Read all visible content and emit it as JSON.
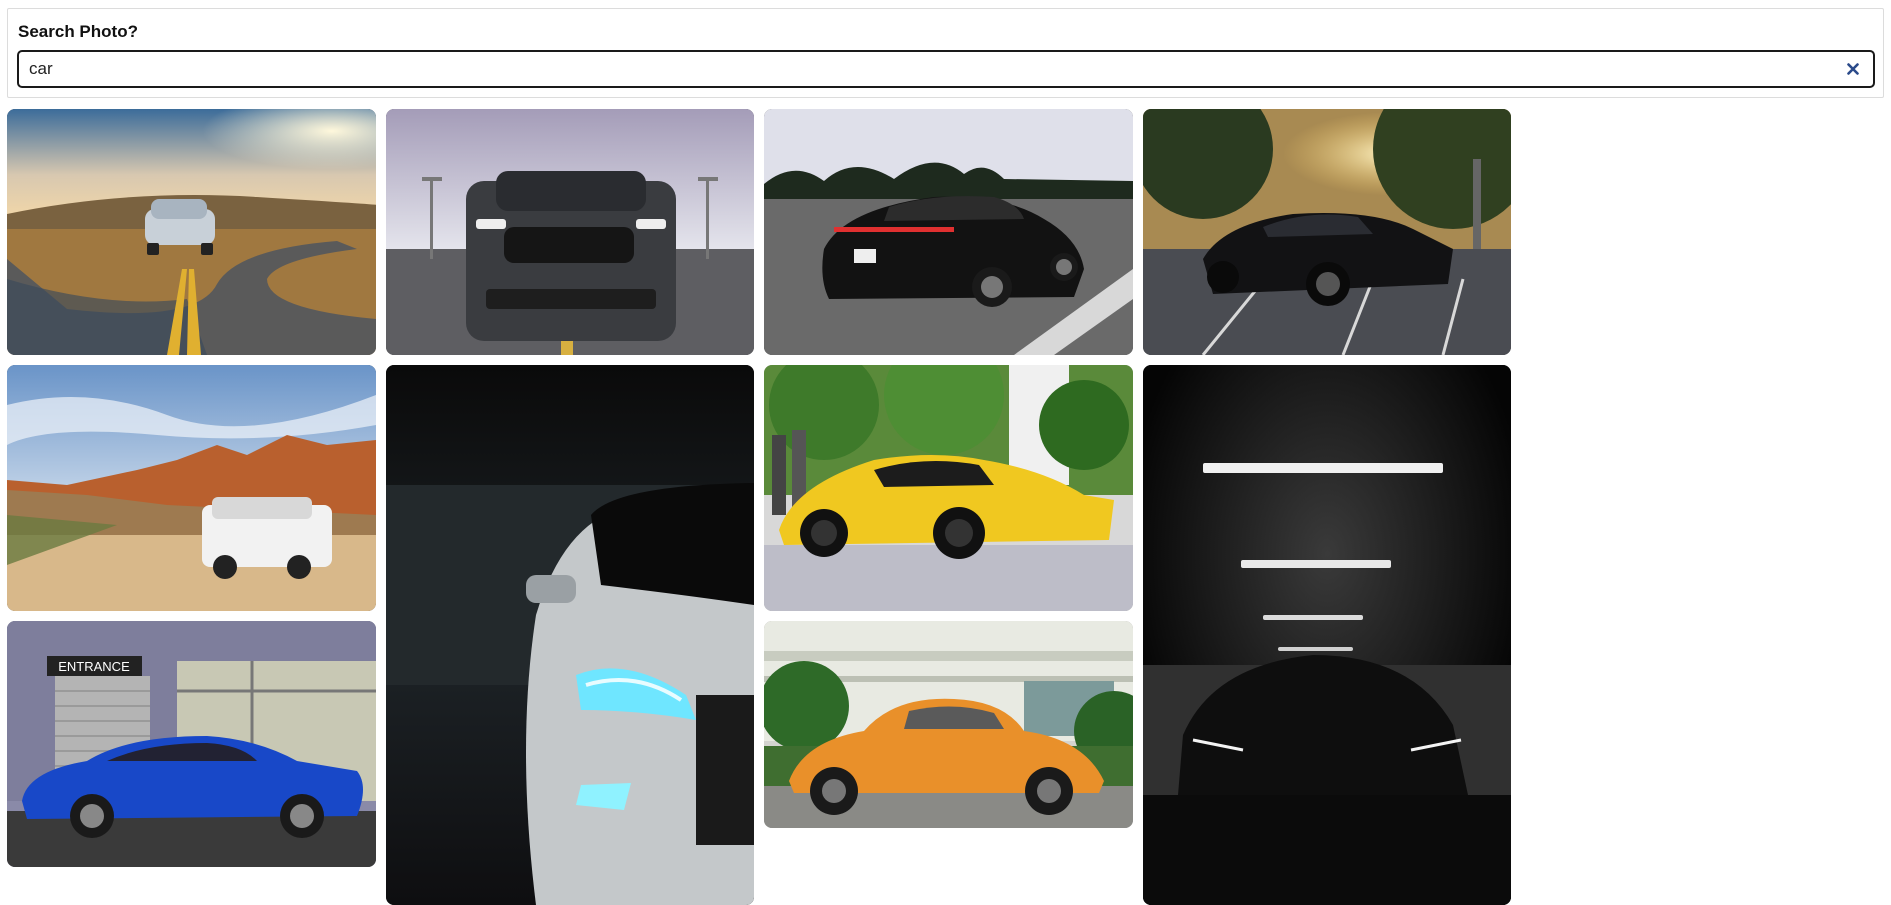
{
  "search": {
    "label": "Search Photo?",
    "value": "car",
    "clear_icon": "close-icon"
  },
  "gallery": {
    "photos": [
      {
        "subject": "silver sports car on winding road at sunset"
      },
      {
        "subject": "dark grey muscle car front view"
      },
      {
        "subject": "black sedan on highway"
      },
      {
        "subject": "black muscle car in parking lot"
      },
      {
        "subject": "white SUV in desert"
      },
      {
        "subject": "white car headlight close-up in dark"
      },
      {
        "subject": "yellow supercar"
      },
      {
        "subject": "black car in dark garage"
      },
      {
        "subject": "blue coupe in front of entrance",
        "sign_text": "ENTRANCE"
      },
      {
        "subject": "orange vintage beetle"
      }
    ]
  },
  "colors": {
    "accent": "#2b4a8a",
    "border": "#1a1a1a"
  }
}
